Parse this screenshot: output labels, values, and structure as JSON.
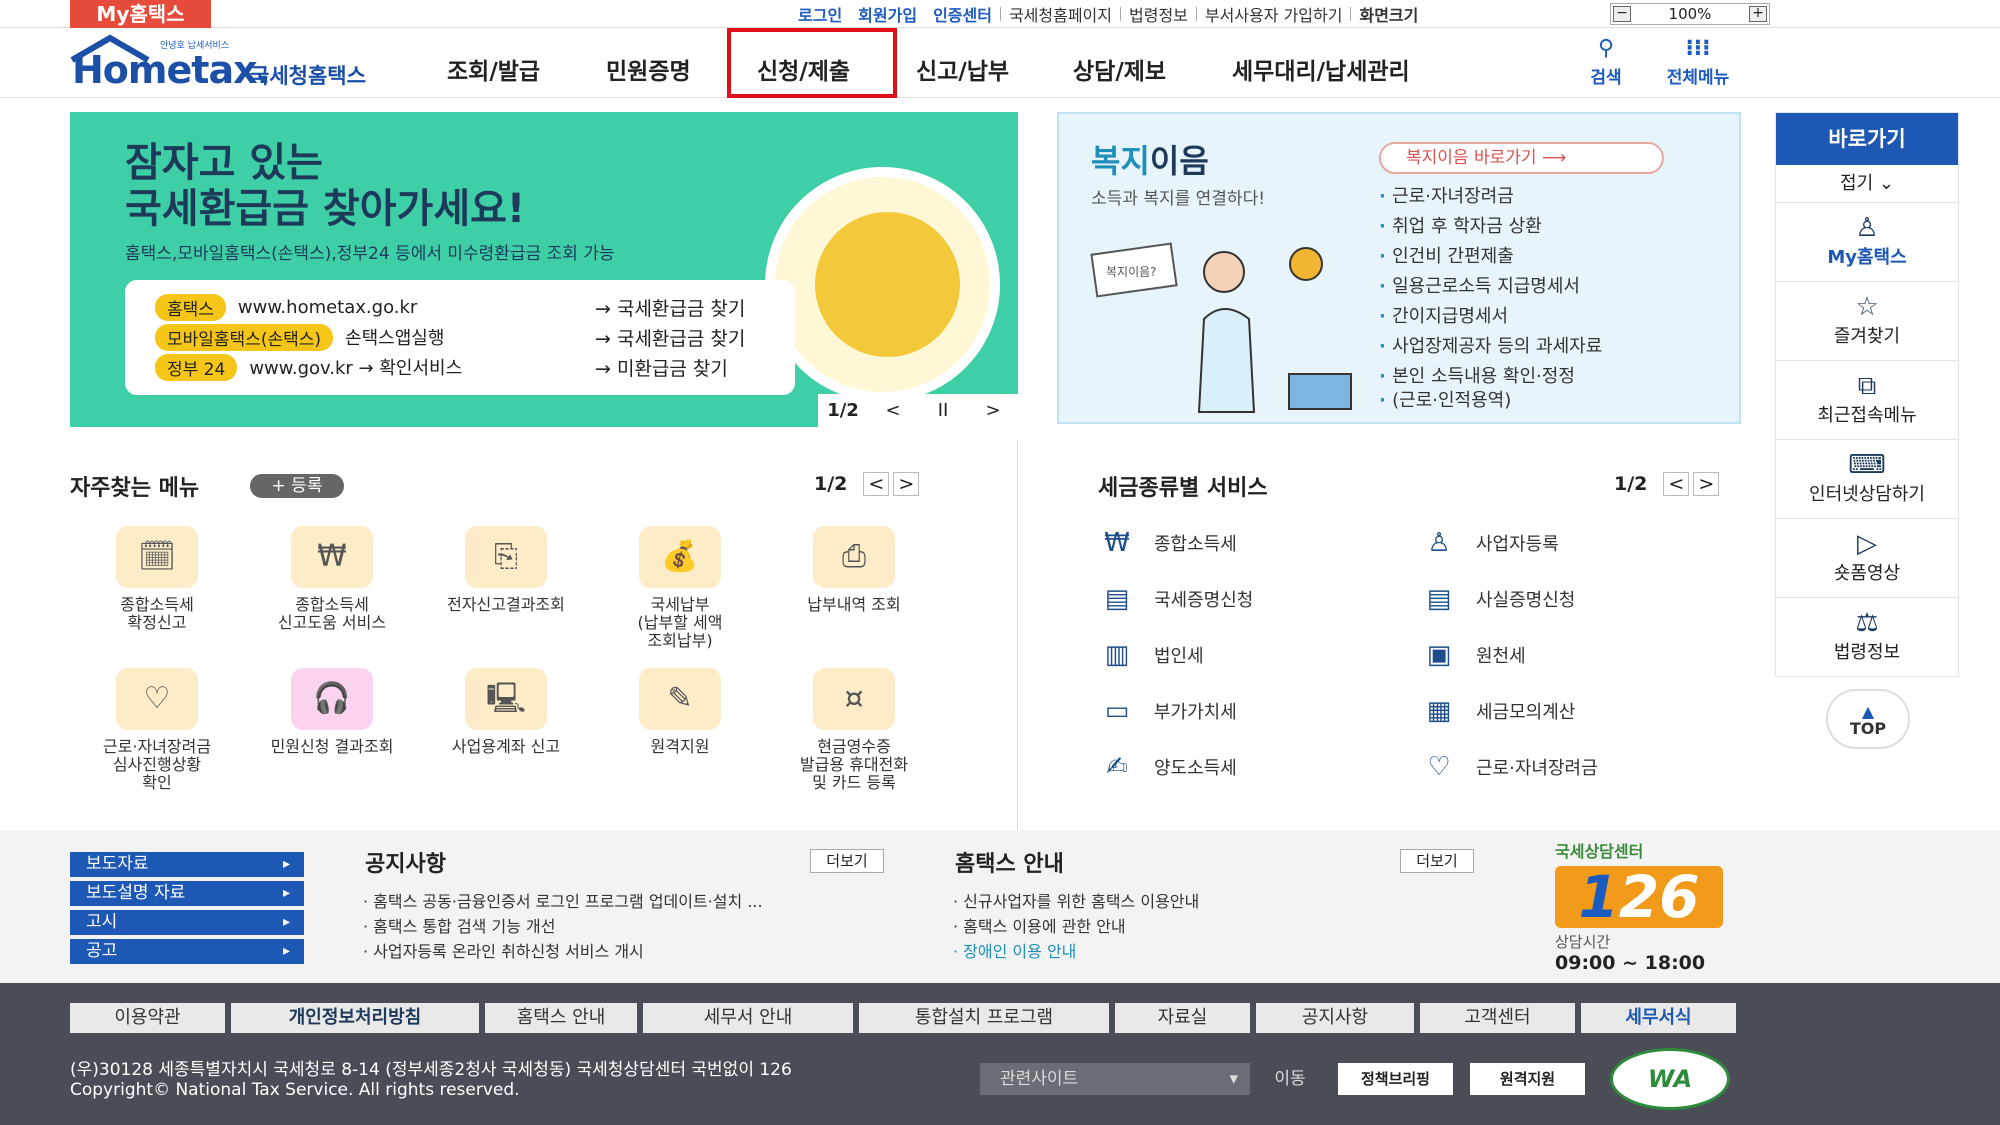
{
  "topbar": {
    "my_label": "My홈택스",
    "links": [
      "로그인",
      "회원가입",
      "인증센터",
      "국세청홈페이지",
      "법령정보",
      "부서사용자 가입하기",
      "화면크기"
    ],
    "zoom": "100%",
    "zoom_minus": "−",
    "zoom_plus": "+"
  },
  "header": {
    "logo_sub": "안녕호 납세서비스",
    "logo_main": "Hometax.",
    "logo_kr": "국세청홈택스",
    "nav": [
      "조회/발급",
      "민원증명",
      "신청/제출",
      "신고/납부",
      "상담/제보",
      "세무대리/납세관리"
    ],
    "search_label": "검색",
    "allmenu_label": "전체메뉴",
    "colors": {
      "brand": "#1c4fa6",
      "highlight": "#e0101a"
    }
  },
  "banner": {
    "title_line1": "잠자고 있는",
    "title_line2": "국세환급금 찾아가세요!",
    "subtitle": "홈택스,모바일홈택스(손택스),정부24 등에서 미수령환급금 조회 가능",
    "rows": [
      {
        "tag": "홈택스",
        "text": "www.hometax.go.kr",
        "arrow": "→ 국세환급금 찾기"
      },
      {
        "tag": "모바일홈택스(손택스)",
        "text": "손택스앱실행",
        "arrow": "→ 국세환급금 찾기"
      },
      {
        "tag": "정부 24",
        "text": "www.gov.kr → 확인서비스",
        "arrow": "→ 미환급금 찾기"
      }
    ],
    "page": "1/2",
    "prev": "<",
    "pause": "II",
    "next": ">"
  },
  "welfare": {
    "title_a": "복지",
    "title_b": "이음",
    "desc": "소득과 복지를 연결하다!",
    "go_label": "복지이음 바로가기  ⟶",
    "items": [
      "근로·자녀장려금",
      "취업 후 학자금 상환",
      "인건비 간편제출",
      "일용근로소득 지급명세서",
      "간이지급명세서",
      "사업장제공자 등의 과세자료",
      "본인 소득내용 확인·정정",
      "(근로·인적용역)"
    ],
    "illu_caption": "복지이음?"
  },
  "quick": {
    "title": "바로가기",
    "fold": "접기 ⌄",
    "items": [
      {
        "label": "My홈택스",
        "icon": "person-icon"
      },
      {
        "label": "즐겨찾기",
        "icon": "star-icon"
      },
      {
        "label": "최근접속메뉴",
        "icon": "recent-icon"
      },
      {
        "label": "인터넷상담하기",
        "icon": "laptop-icon"
      },
      {
        "label": "숏폼영상",
        "icon": "play-icon"
      },
      {
        "label": "법령정보",
        "icon": "gavel-icon"
      }
    ],
    "top_label": "TOP"
  },
  "favorites": {
    "title": "자주찾는 메뉴",
    "register": "+ 등록",
    "page": "1/2",
    "items": [
      [
        "종합소득세",
        "확정신고"
      ],
      [
        "종합소득세",
        "신고도움 서비스"
      ],
      [
        "전자신고결과조회"
      ],
      [
        "국세납부",
        "(납부할 세액",
        "조회납부)"
      ],
      [
        "납부내역 조회"
      ],
      [
        "근로·자녀장려금",
        "심사진행상황",
        "확인"
      ],
      [
        "민원신청 결과조회"
      ],
      [
        "사업용계좌 신고"
      ],
      [
        "원격지원"
      ],
      [
        "현금영수증",
        "발급용 휴대전화",
        "및 카드 등록"
      ]
    ]
  },
  "tax_services": {
    "title": "세금종류별 서비스",
    "page": "1/2",
    "left": [
      "종합소득세",
      "국세증명신청",
      "법인세",
      "부가가치세",
      "양도소득세"
    ],
    "right": [
      "사업자등록",
      "사실증명신청",
      "원천세",
      "세금모의계산",
      "근로·자녀장려금"
    ]
  },
  "info": {
    "left_buttons": [
      "보도자료",
      "보도설명 자료",
      "고시",
      "공고"
    ],
    "notice_title": "공지사항",
    "notice_more": "더보기",
    "notices": [
      "홈택스 공동·금융인증서 로그인 프로그램 업데이트·설치 ...",
      "홈택스 통합 검색 기능 개선",
      "사업자등록 온라인 취하신청 서비스 개시"
    ],
    "guide_title": "홈택스 안내",
    "guide_more": "더보기",
    "guides": [
      "신규사업자를 위한 홈택스 이용안내",
      "홈택스 이용에 관한 안내",
      "장애인 이용 안내"
    ],
    "center_title": "국세상담센터",
    "center_number_a": "1",
    "center_number_b": "26",
    "center_hours_label": "상담시간",
    "center_hours": "09:00 ~ 18:00"
  },
  "footer": {
    "tabs": [
      "이용약관",
      "개인정보처리방침",
      "홈택스 안내",
      "세무서 안내",
      "통합설치 프로그램",
      "자료실",
      "공지사항",
      "고객센터",
      "세무서식"
    ],
    "address": "(우)30128 세종특별자치시 국세청로 8-14 (정부세종2청사 국세청동) 국세청상담센터 국번없이 126",
    "copyright": "Copyright© National Tax Service. All rights reserved.",
    "related_site": "관련사이트",
    "move": "이동",
    "btn_policy": "정책브리핑",
    "btn_remote": "원격지원",
    "wa_mark": "WA"
  }
}
